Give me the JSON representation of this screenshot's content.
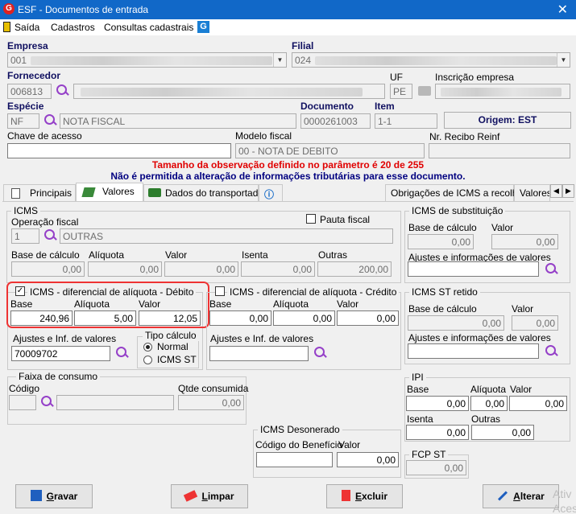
{
  "window": {
    "title": "ESF - Documentos de entrada",
    "close": "✕"
  },
  "menu": {
    "saida": "Saída",
    "cadastros": "Cadastros",
    "consultas": "Consultas cadastrais"
  },
  "header": {
    "empresa_label": "Empresa",
    "empresa_value": "001",
    "filial_label": "Filial",
    "filial_value": "024",
    "fornecedor_label": "Fornecedor",
    "fornecedor_value": "006813",
    "uf_label": "UF",
    "uf_value": "PE",
    "inscricao_label": "Inscrição empresa",
    "especie_label": "Espécie",
    "especie_code": "NF",
    "especie_desc": "NOTA FISCAL",
    "documento_label": "Documento",
    "documento_value": "0000261003",
    "item_label": "Item",
    "item_value": "1-1",
    "origem": "Origem: EST",
    "chave_label": "Chave de acesso",
    "chave_value": "",
    "modelo_label": "Modelo fiscal",
    "modelo_value": "00 - NOTA DE DEBITO",
    "recibo_label": "Nr. Recibo Reinf",
    "recibo_value": ""
  },
  "messages": {
    "warning": "Tamanho da observação definido no parâmetro é 20 de 255",
    "info": "Não é permitida a alteração de informações tributárias para esse documento."
  },
  "tabs": [
    "Principais",
    "Valores",
    "Dados do transportador",
    "Obrigações de ICMS a recolher",
    "Valores"
  ],
  "icms": {
    "group": "ICMS",
    "operacao_label": "Operação fiscal",
    "operacao_code": "1",
    "operacao_desc": "OUTRAS",
    "pauta_label": "Pauta fiscal",
    "base_label": "Base de cálculo",
    "base": "0,00",
    "aliquota_label": "Alíquota",
    "aliquota": "0,00",
    "valor_label": "Valor",
    "valor": "0,00",
    "isenta_label": "Isenta",
    "isenta": "0,00",
    "outras_label": "Outras",
    "outras": "200,00"
  },
  "difal_debito": {
    "title": "ICMS - diferencial de alíquota - Débito",
    "check": "✓",
    "base_label": "Base",
    "base": "240,96",
    "aliquota_label": "Alíquota",
    "aliquota": "5,00",
    "valor_label": "Valor",
    "valor": "12,05",
    "ajustes_label": "Ajustes e Inf. de valores",
    "ajustes_value": "70009702",
    "tipo_label": "Tipo cálculo",
    "tipo_normal": "Normal",
    "tipo_st": "ICMS ST"
  },
  "difal_credito": {
    "title": "ICMS - diferencial de alíquota - Crédito",
    "base_label": "Base",
    "base": "0,00",
    "aliquota_label": "Alíquota",
    "aliquota": "0,00",
    "valor_label": "Valor",
    "valor": "0,00",
    "ajustes_label": "Ajustes e Inf. de valores"
  },
  "substituicao": {
    "group": "ICMS de substituição",
    "base_label": "Base de cálculo",
    "base": "0,00",
    "valor_label": "Valor",
    "valor": "0,00",
    "ajustes_label": "Ajustes e informações de valores"
  },
  "st_retido": {
    "group": "ICMS ST retido",
    "base_label": "Base de cálculo",
    "base": "0,00",
    "valor_label": "Valor",
    "valor": "0,00",
    "ajustes_label": "Ajustes e informações de valores"
  },
  "faixa": {
    "group": "Faixa de consumo",
    "codigo_label": "Código",
    "qtde_label": "Qtde consumida",
    "qtde": "0,00"
  },
  "desonerado": {
    "group": "ICMS Desonerado",
    "codigo_label": "Código do Benefício",
    "valor_label": "Valor",
    "valor": "0,00"
  },
  "ipi": {
    "group": "IPI",
    "base_label": "Base",
    "base": "0,00",
    "aliquota_label": "Alíquota",
    "aliquota": "0,00",
    "valor_label": "Valor",
    "valor": "0,00",
    "isenta_label": "Isenta",
    "isenta": "0,00",
    "outras_label": "Outras",
    "outras": "0,00"
  },
  "fcp": {
    "group": "FCP ST",
    "valor": "0,00"
  },
  "buttons": {
    "gravar_u": "G",
    "gravar_rest": "ravar",
    "limpar_u": "L",
    "limpar_rest": "impar",
    "excluir_u": "E",
    "excluir_rest": "xcluir",
    "alterar_u": "A",
    "alterar_rest": "lterar"
  },
  "watermark": {
    "line1": "Ativ",
    "line2": "Aces"
  },
  "colors": {
    "titlebar": "#1168c8",
    "warning": "#e00000",
    "info": "#000080",
    "highlight": "#e33333"
  }
}
